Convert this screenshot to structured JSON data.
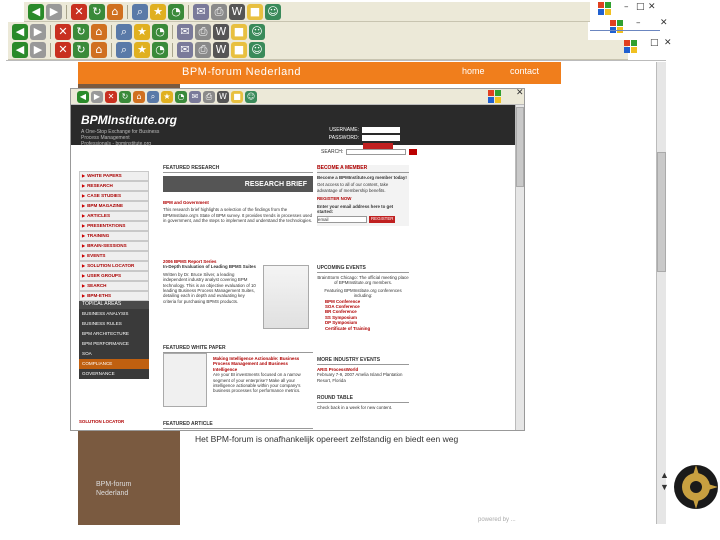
{
  "browser": {
    "toolbar_icons": [
      "back-icon",
      "forward-icon",
      "stop-icon",
      "refresh-icon",
      "home-icon",
      "search-icon",
      "favorites-icon",
      "history-icon",
      "mail-icon",
      "print-icon",
      "edit-icon",
      "discuss-icon",
      "messenger-icon"
    ]
  },
  "forum_site": {
    "banner_title": "BPM-forum Nederland",
    "nav_home": "home",
    "nav_contact": "contact",
    "side_footer_lines": [
      "BPM-forum",
      "Nederland"
    ]
  },
  "bpm_institute": {
    "logo": "BPMInstitute.org",
    "tagline": "A One-Stop Exchange for Business Process Management Professionals - bpminstitute.org",
    "login": {
      "username_label": "USERNAME:",
      "password_label": "PASSWORD:",
      "search_label": "SEARCH:"
    },
    "nav_items": [
      "WHITE PAPERS",
      "RESEARCH",
      "CASE STUDIES",
      "BPM MAGAZINE",
      "ARTICLES",
      "PRESENTATIONS",
      "TRAINING",
      "BRAIN-SESSIONS",
      "EVENTS",
      "SOLUTION LOCATOR",
      "USER GROUPS",
      "SEARCH",
      "BPM-ETHS",
      "REVIEW"
    ],
    "topical_head": "TOPICAL AREAS",
    "topical_items": [
      "BUSINESS ANALYSIS",
      "BUSINESS RULES",
      "BPM ARCHITECTURE",
      "BPM PERFORMANCE",
      "SOA",
      "COMPLIANCE",
      "GOVERNANCE"
    ],
    "featured_research": {
      "heading": "FEATURED RESEARCH",
      "brief_label": "RESEARCH BRIEF",
      "title": "BPM and Government",
      "body": "This research brief highlights a selection of the findings from the BPMInstitute.org's State of BPM survey. It provides trends in processes used in government, and the steps to implement and understand the technologies."
    },
    "survey": {
      "heading": "2006 BPMS Report Series",
      "subtitle": "In-Depth Evaluation of Leading BPMS Suites",
      "body": "Written by Dr. Bruce Silver, a leading independent industry analyst covering BPM technology. This is an objective evaluation of 10 leading Business Process Management Suites, detailing each in depth and evaluating key criteria for purchasing BPMS products."
    },
    "white_paper": {
      "heading": "FEATURED WHITE PAPER",
      "title": "Making Intelligence Actionable: Business Process Management and Business Intelligence",
      "body": "Are your BI investments focused on a narrow segment of your enterprise? Make all your intelligence actionable within your company's business processes for performance metrics."
    },
    "featured_article": "FEATURED ARTICLE",
    "become_member": {
      "heading": "BECOME A MEMBER",
      "title": "Become a BPMInstitute.org member today!",
      "body": "Get access to all of our content, take advantage of membership benefits.",
      "register": "REGISTER NOW",
      "email_prompt": "Enter your email address here to get started:",
      "email_placeholder": "email",
      "button": "REGISTER"
    },
    "upcoming_events": {
      "heading": "UPCOMING EVENTS",
      "body": "BrainStorm Chicago: The official meeting place of BPMInstitute.org members.",
      "featuring": "Featuring BPMInstitute.org conferences including:",
      "items": [
        "BPM Conference",
        "SOA Conference",
        "BR Conference",
        "SS Symposium",
        "DP Symposium",
        "Certificate of Training"
      ]
    },
    "more_events": {
      "heading": "MORE INDUSTRY EVENTS",
      "title": "ARIS ProcessWorld",
      "body": "February 7-9, 2007 Amelia Island Plantation Resort, Florida"
    },
    "round_table": {
      "heading": "ROUND TABLE",
      "body": "Check back in a week for new content."
    },
    "solution_locator": "SOLUTION LOCATOR"
  },
  "bottom": {
    "text": "Het BPM-forum is onafhankelijk opereert zelfstandig en biedt een weg"
  },
  "colors": {
    "banner_orange": "#f07e1c",
    "nav_red": "#b00000",
    "header_dark": "#2a2a2a"
  }
}
